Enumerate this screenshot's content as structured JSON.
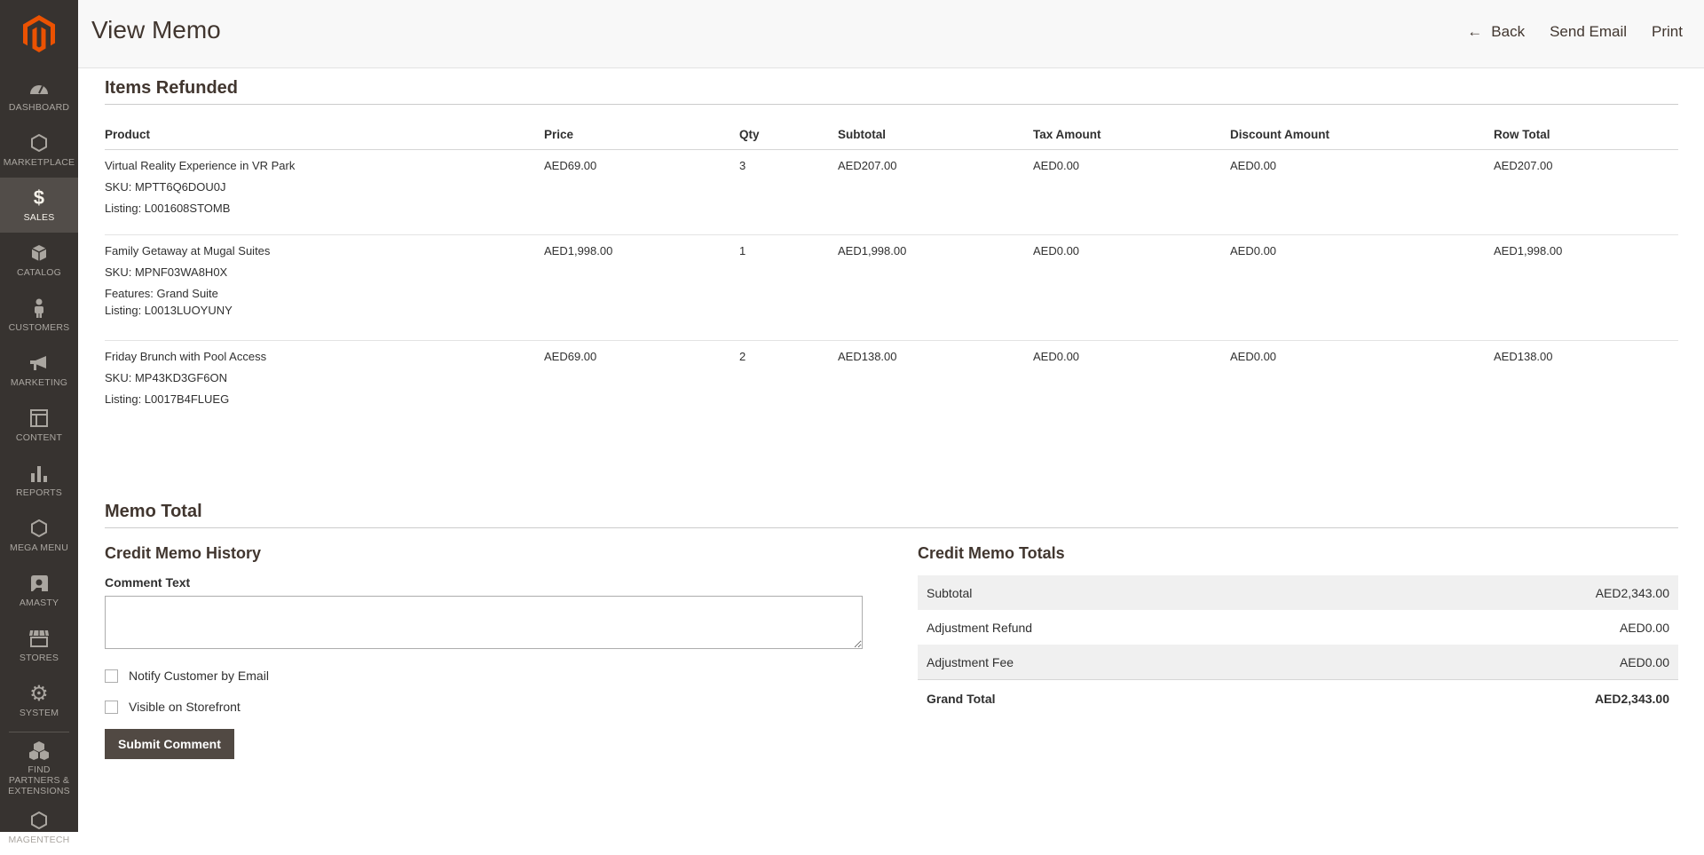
{
  "sidebar": {
    "items": [
      {
        "label": "DASHBOARD",
        "icon": "dashboard-icon"
      },
      {
        "label": "MARKETPLACE",
        "icon": "marketplace-icon"
      },
      {
        "label": "SALES",
        "icon": "dollar-icon"
      },
      {
        "label": "CATALOG",
        "icon": "box-icon"
      },
      {
        "label": "CUSTOMERS",
        "icon": "person-icon"
      },
      {
        "label": "MARKETING",
        "icon": "megaphone-icon"
      },
      {
        "label": "CONTENT",
        "icon": "layout-icon"
      },
      {
        "label": "REPORTS",
        "icon": "bar-chart-icon"
      },
      {
        "label": "MEGA MENU",
        "icon": "hexagon-icon"
      },
      {
        "label": "AMASTY",
        "icon": "amasty-icon"
      },
      {
        "label": "STORES",
        "icon": "store-icon"
      },
      {
        "label": "SYSTEM",
        "icon": "gear-icon"
      },
      {
        "label": "FIND PARTNERS & EXTENSIONS",
        "icon": "boxes-icon"
      },
      {
        "label": "MAGENTECH",
        "icon": "hexagon-icon"
      }
    ],
    "active": "SALES"
  },
  "header": {
    "title": "View Memo",
    "back_label": "Back",
    "send_email_label": "Send Email",
    "print_label": "Print"
  },
  "items_refunded": {
    "title": "Items Refunded",
    "columns": [
      "Product",
      "Price",
      "Qty",
      "Subtotal",
      "Tax Amount",
      "Discount Amount",
      "Row Total"
    ],
    "rows": [
      {
        "name": "Virtual Reality Experience in VR Park",
        "sku": "SKU: MPTT6Q6DOU0J",
        "features": "",
        "listing": "Listing:  L001608STOMB",
        "price": "AED69.00",
        "qty": "3",
        "subtotal": "AED207.00",
        "tax": "AED0.00",
        "discount": "AED0.00",
        "row_total": "AED207.00"
      },
      {
        "name": "Family Getaway at Mugal Suites",
        "sku": "SKU: MPNF03WA8H0X",
        "features": "Features:  Grand Suite",
        "listing": "Listing:  L0013LUOYUNY",
        "price": "AED1,998.00",
        "qty": "1",
        "subtotal": "AED1,998.00",
        "tax": "AED0.00",
        "discount": "AED0.00",
        "row_total": "AED1,998.00"
      },
      {
        "name": "Friday Brunch with Pool Access",
        "sku": "SKU: MP43KD3GF6ON",
        "features": "",
        "listing": "Listing:  L0017B4FLUEG",
        "price": "AED69.00",
        "qty": "2",
        "subtotal": "AED138.00",
        "tax": "AED0.00",
        "discount": "AED0.00",
        "row_total": "AED138.00"
      }
    ]
  },
  "memo_total": {
    "title": "Memo Total",
    "history": {
      "title": "Credit Memo History",
      "comment_label": "Comment Text",
      "comment_value": "",
      "notify_label": "Notify Customer by Email",
      "notify_checked": false,
      "visible_label": "Visible on Storefront",
      "visible_checked": false,
      "submit_label": "Submit Comment"
    },
    "totals": {
      "title": "Credit Memo Totals",
      "rows": [
        {
          "label": "Subtotal",
          "value": "AED2,343.00"
        },
        {
          "label": "Adjustment Refund",
          "value": "AED0.00"
        },
        {
          "label": "Adjustment Fee",
          "value": "AED0.00"
        }
      ],
      "grand_label": "Grand Total",
      "grand_value": "AED2,343.00"
    }
  },
  "colors": {
    "sidebar_bg": "#373330",
    "sidebar_active": "#524d49",
    "logo_orange": "#eb5202",
    "button_bg": "#514943"
  }
}
